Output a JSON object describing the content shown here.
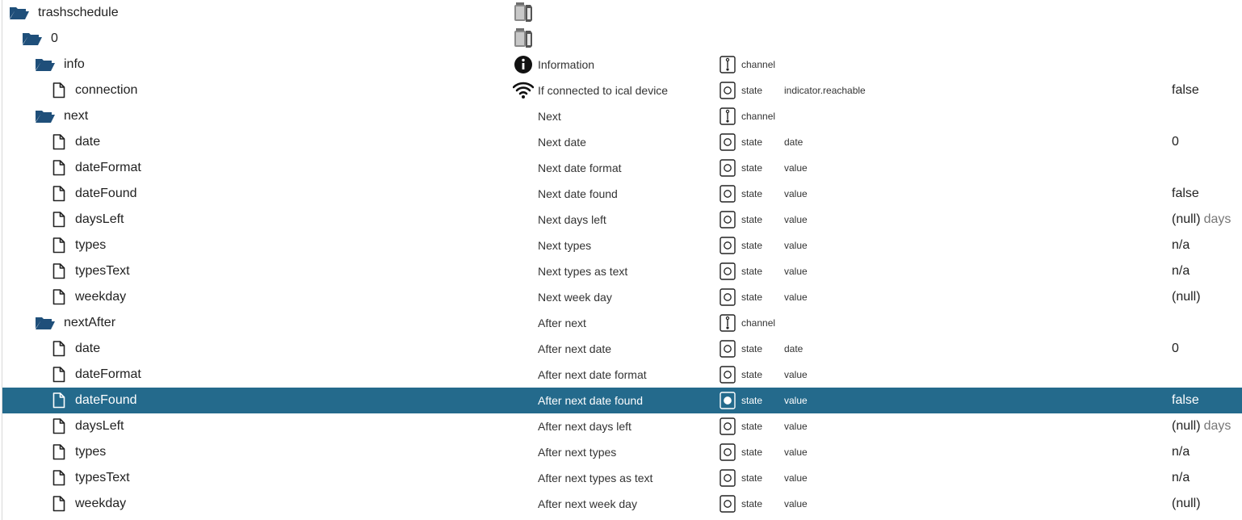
{
  "tree": {
    "rows": [
      {
        "name": "trashschedule",
        "kind": "folder",
        "depth": 0,
        "desc": "",
        "type": "",
        "role": "",
        "value": "",
        "unit": "",
        "descIcon": "adapter-icon"
      },
      {
        "name": "0",
        "kind": "folder",
        "depth": 1,
        "desc": "",
        "type": "",
        "role": "",
        "value": "",
        "unit": "",
        "descIcon": "adapter-icon"
      },
      {
        "name": "info",
        "kind": "folder",
        "depth": 2,
        "desc": "Information",
        "type": "channel",
        "role": "",
        "value": "",
        "unit": "",
        "descIcon": "info-icon"
      },
      {
        "name": "connection",
        "kind": "file",
        "depth": 3,
        "desc": "If connected to ical device",
        "type": "state",
        "role": "indicator.reachable",
        "value": "false",
        "unit": "",
        "descIcon": "wifi-icon"
      },
      {
        "name": "next",
        "kind": "folder",
        "depth": 2,
        "desc": "Next",
        "type": "channel",
        "role": "",
        "value": "",
        "unit": "",
        "descIcon": ""
      },
      {
        "name": "date",
        "kind": "file",
        "depth": 3,
        "desc": "Next date",
        "type": "state",
        "role": "date",
        "value": "0",
        "unit": "",
        "descIcon": ""
      },
      {
        "name": "dateFormat",
        "kind": "file",
        "depth": 3,
        "desc": "Next date format",
        "type": "state",
        "role": "value",
        "value": "",
        "unit": "",
        "descIcon": ""
      },
      {
        "name": "dateFound",
        "kind": "file",
        "depth": 3,
        "desc": "Next date found",
        "type": "state",
        "role": "value",
        "value": "false",
        "unit": "",
        "descIcon": ""
      },
      {
        "name": "daysLeft",
        "kind": "file",
        "depth": 3,
        "desc": "Next days left",
        "type": "state",
        "role": "value",
        "value": "(null)",
        "unit": "days",
        "descIcon": ""
      },
      {
        "name": "types",
        "kind": "file",
        "depth": 3,
        "desc": "Next types",
        "type": "state",
        "role": "value",
        "value": "n/a",
        "unit": "",
        "descIcon": ""
      },
      {
        "name": "typesText",
        "kind": "file",
        "depth": 3,
        "desc": "Next types as text",
        "type": "state",
        "role": "value",
        "value": "n/a",
        "unit": "",
        "descIcon": ""
      },
      {
        "name": "weekday",
        "kind": "file",
        "depth": 3,
        "desc": "Next week day",
        "type": "state",
        "role": "value",
        "value": "(null)",
        "unit": "",
        "descIcon": ""
      },
      {
        "name": "nextAfter",
        "kind": "folder",
        "depth": 2,
        "desc": "After next",
        "type": "channel",
        "role": "",
        "value": "",
        "unit": "",
        "descIcon": ""
      },
      {
        "name": "date",
        "kind": "file",
        "depth": 3,
        "desc": "After next date",
        "type": "state",
        "role": "date",
        "value": "0",
        "unit": "",
        "descIcon": ""
      },
      {
        "name": "dateFormat",
        "kind": "file",
        "depth": 3,
        "desc": "After next date format",
        "type": "state",
        "role": "value",
        "value": "",
        "unit": "",
        "descIcon": ""
      },
      {
        "name": "dateFound",
        "kind": "file",
        "depth": 3,
        "desc": "After next date found",
        "type": "state",
        "role": "value",
        "value": "false",
        "unit": "",
        "descIcon": "",
        "selected": true
      },
      {
        "name": "daysLeft",
        "kind": "file",
        "depth": 3,
        "desc": "After next days left",
        "type": "state",
        "role": "value",
        "value": "(null)",
        "unit": "days",
        "descIcon": ""
      },
      {
        "name": "types",
        "kind": "file",
        "depth": 3,
        "desc": "After next types",
        "type": "state",
        "role": "value",
        "value": "n/a",
        "unit": "",
        "descIcon": ""
      },
      {
        "name": "typesText",
        "kind": "file",
        "depth": 3,
        "desc": "After next types as text",
        "type": "state",
        "role": "value",
        "value": "n/a",
        "unit": "",
        "descIcon": ""
      },
      {
        "name": "weekday",
        "kind": "file",
        "depth": 3,
        "desc": "After next week day",
        "type": "state",
        "role": "value",
        "value": "(null)",
        "unit": "",
        "descIcon": ""
      }
    ]
  },
  "colors": {
    "selected": "#246a8c",
    "folder": "#1f4f7a"
  }
}
